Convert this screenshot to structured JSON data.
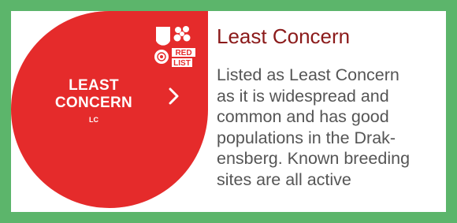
{
  "status": {
    "line1": "LEAST",
    "line2": "CONCERN",
    "code": "LC",
    "logo_text": "RED LIST",
    "color": "#e52b2b"
  },
  "frame_color": "#5cb56b",
  "title": "Least Concern",
  "title_color": "#8b1a1a",
  "description_lines": [
    "Listed as Least Concern",
    "as it is widespread and",
    "common and has good",
    "populations in the Drak-",
    "ensberg. Known breeding",
    "sites are all active"
  ],
  "icons": {
    "chevron": "chevron-right-icon",
    "logo": "iucn-red-list-logo"
  }
}
